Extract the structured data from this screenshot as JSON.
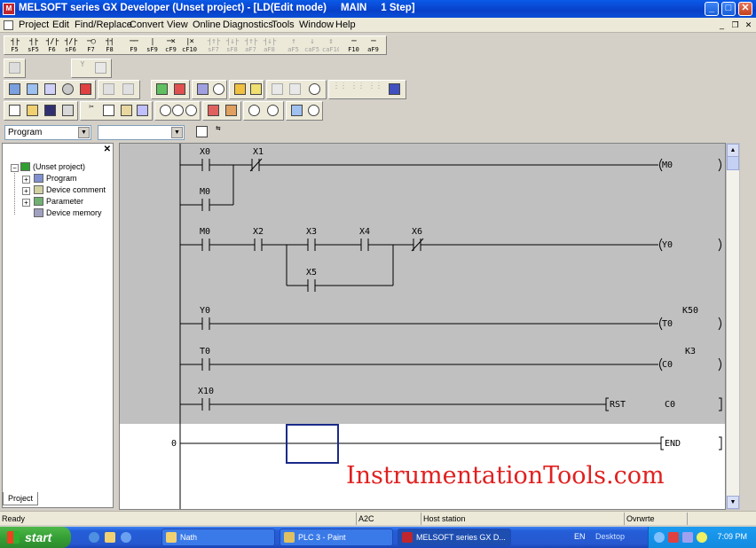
{
  "window": {
    "title": "MELSOFT series GX Developer (Unset project) - [LD(Edit mode)     MAIN     1 Step]",
    "buttons": {
      "minimize": "_",
      "maximize": "□",
      "close": "✕"
    }
  },
  "menubar": {
    "items": [
      "Project",
      "Edit",
      "Find/Replace",
      "Convert",
      "View",
      "Online",
      "Diagnostics",
      "Tools",
      "Window",
      "Help"
    ]
  },
  "toolbar_ladder_keys": [
    {
      "glyph": "┤├",
      "label": "F5"
    },
    {
      "glyph": "┤├",
      "label": "sF5"
    },
    {
      "glyph": "┤/├",
      "label": "F6"
    },
    {
      "glyph": "┤/├",
      "label": "sF6"
    },
    {
      "glyph": "─○",
      "label": "F7"
    },
    {
      "glyph": "┤┤",
      "label": "F8"
    },
    {
      "glyph": "──",
      "label": "F9"
    },
    {
      "glyph": "│",
      "label": "sF9"
    },
    {
      "glyph": "─×",
      "label": "cF9"
    },
    {
      "glyph": "│×",
      "label": "cF10"
    },
    {
      "glyph": "┤↑├",
      "label": "sF7",
      "dim": true
    },
    {
      "glyph": "┤↓├",
      "label": "sF8",
      "dim": true
    },
    {
      "glyph": "┤↑├",
      "label": "aF7",
      "dim": true
    },
    {
      "glyph": "┤↓├",
      "label": "aF8",
      "dim": true
    },
    {
      "glyph": "↑",
      "label": "aF5",
      "dim": true
    },
    {
      "glyph": "↓",
      "label": "caF5",
      "dim": true
    },
    {
      "glyph": "↕",
      "label": "caF10",
      "dim": true
    },
    {
      "glyph": "─",
      "label": "F10"
    },
    {
      "glyph": "─",
      "label": "aF9"
    }
  ],
  "combos": {
    "program": "Program",
    "second": ""
  },
  "project_tree": {
    "root": "(Unset project)",
    "items": [
      "Program",
      "Device comment",
      "Parameter",
      "Device memory"
    ],
    "tab": "Project",
    "close": "✕"
  },
  "ladder": {
    "labels": {
      "r1_x0": "X0",
      "r1_x1": "X1",
      "r1_m0": "M0",
      "r1_coil": "M0",
      "r2_m0": "M0",
      "r2_x2": "X2",
      "r2_x3": "X3",
      "r2_x4": "X4",
      "r2_x6": "X6",
      "r2_x5": "X5",
      "r2_coil": "Y0",
      "r3_y0": "Y0",
      "r3_coil": "T0",
      "r3_k": "K50",
      "r4_t0": "T0",
      "r4_coil": "C0",
      "r4_k": "K3",
      "r5_x10": "X10",
      "r5_rst": "RST",
      "r5_c0": "C0",
      "end_step": "0",
      "end_label": "END"
    }
  },
  "statusbar": {
    "ready": "Ready",
    "cpu": "A2C",
    "station": "Host station",
    "mode": "Ovrwrte"
  },
  "taskbar": {
    "start": "start",
    "tasks": [
      "Nath",
      "PLC 3 - Paint",
      "MELSOFT series GX D..."
    ],
    "lang": "EN",
    "desktop": "Desktop",
    "clock": "7:09 PM"
  },
  "watermark": "InstrumentationTools.com"
}
